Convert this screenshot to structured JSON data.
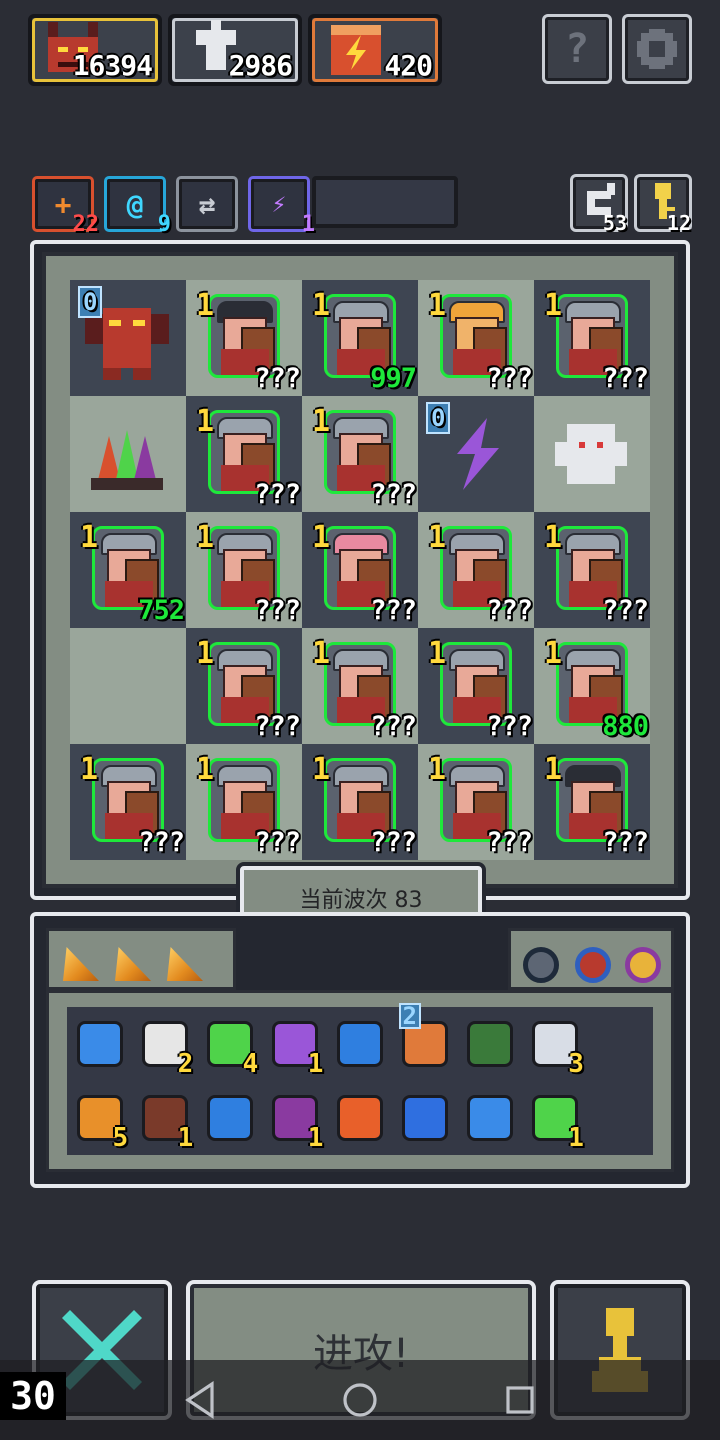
{
  "resources": [
    {
      "icon": "dragon-boss-icon",
      "value": "16394",
      "color": "#e8c23a"
    },
    {
      "icon": "shield-gem-icon",
      "value": "2986",
      "color": "#c8ccd3"
    },
    {
      "icon": "lightning-scroll-icon",
      "value": "420",
      "color": "#e07a3a"
    }
  ],
  "top_buttons": {
    "help": "?",
    "settings_icon": "gear-icon"
  },
  "buffs": [
    {
      "icon": "plus-buff-icon",
      "glyph": "+",
      "count": "22",
      "color": "#d8502e",
      "count_color": "#ff4b4b"
    },
    {
      "icon": "spiral-buff-icon",
      "glyph": "@",
      "count": "9",
      "color": "#27a6d8",
      "count_color": "#3fd7ff"
    },
    {
      "icon": "swap-buff-icon",
      "glyph": "⇄",
      "count": "",
      "color": "#8c939d",
      "count_color": "#fff"
    },
    {
      "icon": "bolt-buff-icon",
      "glyph": "⚡",
      "count": "1",
      "color": "#6f66e8",
      "count_color": "#c27bff"
    }
  ],
  "top_right": [
    {
      "icon": "refresh-icon",
      "count": "53"
    },
    {
      "icon": "key-icon",
      "count": "12"
    }
  ],
  "board": [
    [
      {
        "type": "boss",
        "level": "0",
        "num": ""
      },
      {
        "type": "unit",
        "level": "1",
        "num": "???",
        "tone": "dark"
      },
      {
        "type": "unit",
        "level": "1",
        "num": "997",
        "green": true
      },
      {
        "type": "unit",
        "level": "1",
        "num": "???",
        "tone": "gold"
      },
      {
        "type": "unit",
        "level": "1",
        "num": "???"
      }
    ],
    [
      {
        "type": "crystal",
        "level": "",
        "num": ""
      },
      {
        "type": "unit",
        "level": "1",
        "num": "???"
      },
      {
        "type": "unit",
        "level": "1",
        "num": "???"
      },
      {
        "type": "bolt",
        "level": "0",
        "num": ""
      },
      {
        "type": "ghost",
        "level": "",
        "num": ""
      }
    ],
    [
      {
        "type": "unit",
        "level": "1",
        "num": "752",
        "green": true
      },
      {
        "type": "unit",
        "level": "1",
        "num": "???"
      },
      {
        "type": "unit",
        "level": "1",
        "num": "???",
        "tone": "pink"
      },
      {
        "type": "unit",
        "level": "1",
        "num": "???"
      },
      {
        "type": "unit",
        "level": "1",
        "num": "???"
      }
    ],
    [
      {
        "type": "empty",
        "level": "",
        "num": ""
      },
      {
        "type": "unit",
        "level": "1",
        "num": "???"
      },
      {
        "type": "unit",
        "level": "1",
        "num": "???"
      },
      {
        "type": "unit",
        "level": "1",
        "num": "???"
      },
      {
        "type": "unit",
        "level": "1",
        "num": "880",
        "green": true
      }
    ],
    [
      {
        "type": "unit",
        "level": "1",
        "num": "???"
      },
      {
        "type": "unit",
        "level": "1",
        "num": "???"
      },
      {
        "type": "unit",
        "level": "1",
        "num": "???"
      },
      {
        "type": "unit",
        "level": "1",
        "num": "???",
        "tone": "grey"
      },
      {
        "type": "unit",
        "level": "1",
        "num": "???",
        "tone": "dark"
      }
    ]
  ],
  "wave_label": "当前波次 83",
  "inventory": [
    [
      {
        "icon": "blue-amulet-icon",
        "count": "",
        "color": "#3a8be8"
      },
      {
        "icon": "scroll-icon",
        "count": "2",
        "color": "#e6e6e6"
      },
      {
        "icon": "green-gem-icon",
        "count": "4",
        "color": "#4fd34a"
      },
      {
        "icon": "potion-jar-icon",
        "count": "1",
        "color": "#9a56d8"
      },
      {
        "icon": "blue-wisp-icon",
        "count": "",
        "color": "#2f7fe0"
      },
      {
        "icon": "lightning-scroll-icon",
        "count": "",
        "color": "#e07a3a",
        "pre": "2"
      },
      {
        "icon": "rune-tablet-icon",
        "count": "",
        "color": "#3a7a3a"
      },
      {
        "icon": "white-claw-icon",
        "count": "3",
        "color": "#d8dde6"
      }
    ],
    [
      {
        "icon": "orange-orb-icon",
        "count": "5",
        "color": "#e8902a"
      },
      {
        "icon": "leather-boot-icon",
        "count": "1",
        "color": "#7a3a2a"
      },
      {
        "icon": "water-drop-icon",
        "count": "",
        "color": "#2f7fe0"
      },
      {
        "icon": "demon-mask-icon",
        "count": "1",
        "color": "#8a3aa0"
      },
      {
        "icon": "fire-rune-icon",
        "count": "",
        "color": "#e8602a"
      },
      {
        "icon": "water-rune-icon",
        "count": "",
        "color": "#2f6fe0"
      },
      {
        "icon": "blue-swirl-icon",
        "count": "",
        "color": "#3a8be8"
      },
      {
        "icon": "green-herb-icon",
        "count": "1",
        "color": "#4fd34a"
      }
    ]
  ],
  "attack_label": "进攻!",
  "fps": "30"
}
